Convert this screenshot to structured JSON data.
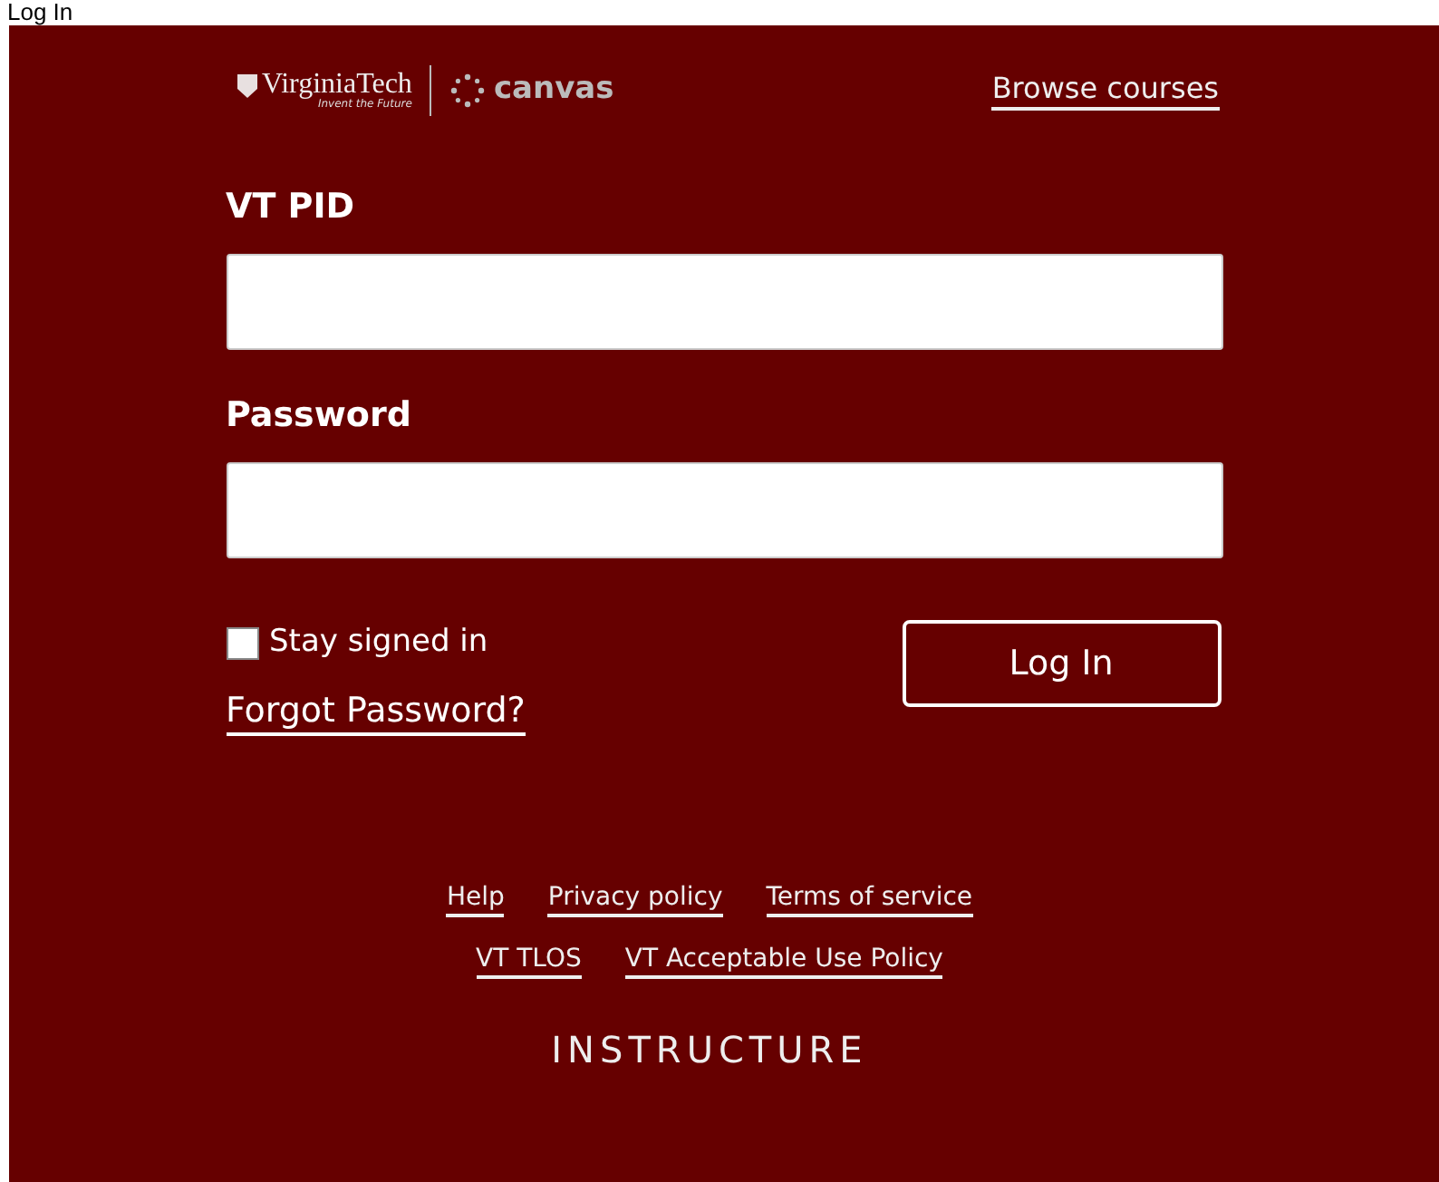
{
  "page_title": "Log In",
  "header": {
    "logo_name": "VirginiaTech",
    "logo_tagline": "Invent the Future",
    "product": "canvas",
    "browse_link": "Browse courses"
  },
  "fields": [
    {
      "label": "VT PID"
    },
    {
      "label": "Password"
    }
  ],
  "stay_signed_in": {
    "label": "Stay signed in",
    "checked": false
  },
  "forgot_link": "Forgot Password?",
  "login_button": "Log In",
  "footer_rows": [
    [
      "Help",
      "Privacy policy",
      "Terms of service"
    ],
    [
      "VT TLOS",
      "VT Acceptable Use Policy"
    ]
  ],
  "footer_brand": "INSTRUCTURE"
}
